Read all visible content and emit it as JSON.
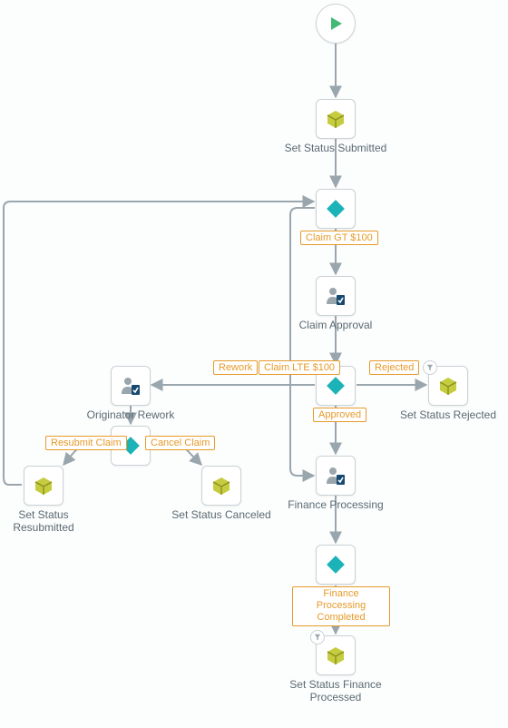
{
  "nodes": {
    "start": {
      "label": ""
    },
    "set_status_submitted": {
      "label": "Set Status Submitted"
    },
    "gateway_claim_gt_100": {
      "label": ""
    },
    "claim_approval": {
      "label": "Claim Approval"
    },
    "gateway_approval_result": {
      "label": ""
    },
    "set_status_rejected": {
      "label": "Set Status Rejected"
    },
    "originator_rework": {
      "label": "Originator Rework"
    },
    "gateway_rework_decision": {
      "label": ""
    },
    "set_status_resubmitted": {
      "label": "Set Status Resubmitted"
    },
    "set_status_canceled": {
      "label": "Set Status Canceled"
    },
    "finance_processing": {
      "label": "Finance Processing"
    },
    "gateway_finance_completed": {
      "label": ""
    },
    "set_status_finance_processed": {
      "label": "Set Status Finance Processed"
    }
  },
  "edge_labels": {
    "claim_gt_100": "Claim GT $100",
    "rework": "Rework",
    "claim_lte_100": "Claim LTE $100",
    "rejected": "Rejected",
    "approved": "Approved",
    "resubmit_claim": "Resubmit Claim",
    "cancel_claim": "Cancel Claim",
    "finance_processing_completed": "Finance Processing Completed"
  },
  "colors": {
    "accent_teal": "#1cb3b8",
    "accent_green_play": "#43b877",
    "accent_olive": "#a4a92a",
    "edge_label_border": "#e79a2a",
    "node_border": "#c9d1d5",
    "text": "#5a6a72",
    "arrow": "#9aa6ad"
  }
}
